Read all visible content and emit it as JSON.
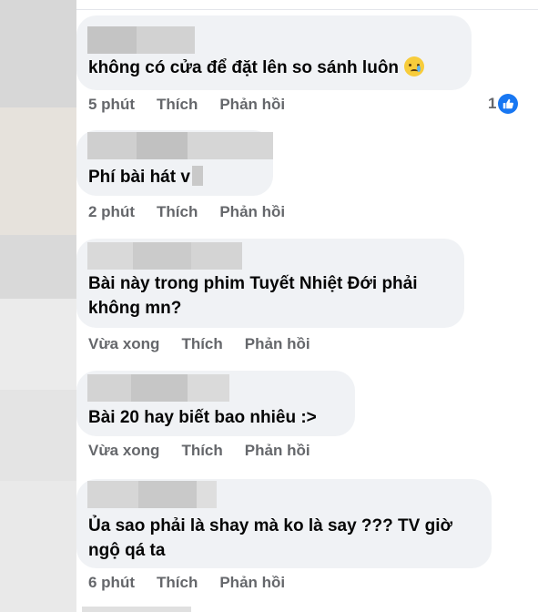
{
  "comments": [
    {
      "text_lines": [
        "không có cửa để đặt lên so sánh luôn"
      ],
      "time": "5 phút",
      "like_label": "Thích",
      "reply_label": "Phản hồi",
      "reaction_count": "1"
    },
    {
      "text_lines": [
        "Phí bài hát v"
      ],
      "time": "2 phút",
      "like_label": "Thích",
      "reply_label": "Phản hồi"
    },
    {
      "text_lines": [
        "Bài này trong phim Tuyết Nhiệt Đới phải",
        "không mn?"
      ],
      "time": "Vừa xong",
      "like_label": "Thích",
      "reply_label": "Phản hồi"
    },
    {
      "text_lines": [
        "Bài 20 hay biết bao nhiêu :>"
      ],
      "time": "Vừa xong",
      "like_label": "Thích",
      "reply_label": "Phản hồi"
    },
    {
      "text_lines": [
        "Ủa sao phải là shay mà ko là say ??? TV giờ",
        "ngộ qá ta"
      ],
      "time": "6 phút",
      "like_label": "Thích",
      "reply_label": "Phản hồi"
    }
  ],
  "icons": {
    "emoji": "crying-face-icon",
    "reaction": "like-icon"
  },
  "colors": {
    "bubble": "#f0f2f5",
    "meta_text": "#65676b",
    "like_blue": "#1877f2"
  }
}
